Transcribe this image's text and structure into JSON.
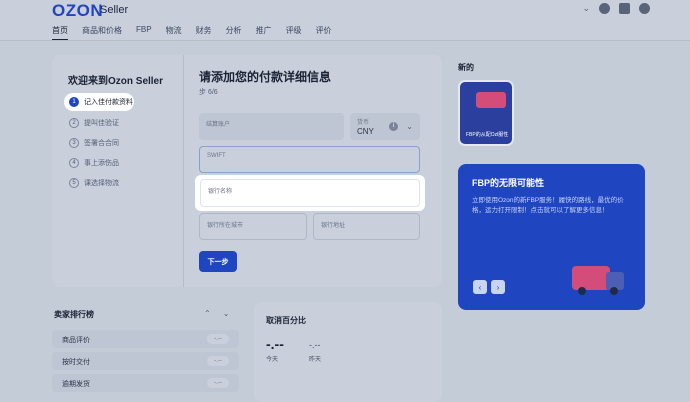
{
  "header": {
    "logo": "OZON",
    "logo_sub": "Seller",
    "nav": [
      "首页",
      "商品和价格",
      "FBP",
      "物流",
      "财务",
      "分析",
      "推广",
      "评级",
      "评价"
    ]
  },
  "onboarding": {
    "welcome": "欢迎来到Ozon Seller",
    "steps": [
      {
        "num": "1",
        "label": "记入佳付款资料"
      },
      {
        "num": "2",
        "label": "提叫佳验证"
      },
      {
        "num": "3",
        "label": "签署合合同"
      },
      {
        "num": "4",
        "label": "事上添伤品"
      },
      {
        "num": "5",
        "label": "课选择物流"
      }
    ],
    "form_title": "请添加您的付款详细信息",
    "form_step": "步 6/6",
    "account_label": "结算账户",
    "currency_label": "货币",
    "currency_value": "CNY",
    "swift_label": "SWIFT",
    "bank_name_label": "银行名称",
    "bank_city_label": "银行所在城市",
    "bank_address_label": "银行地址",
    "next_button": "下一步"
  },
  "new_section": {
    "title": "新的",
    "tile_text": "FBP的从配Ozl服性"
  },
  "promo": {
    "title": "FBP的无限可能性",
    "body": "立即使用Ozon的新FBP服务！履快的路线，最优的价格，运力打开限制！点击就可以了解更多信息！",
    "prev": "‹",
    "next": "›"
  },
  "rankings": {
    "title": "卖家排行榜",
    "rows": [
      {
        "label": "商品评价",
        "value": "-.--"
      },
      {
        "label": "按时交付",
        "value": "-.--"
      },
      {
        "label": "逾期发货",
        "value": "-.--"
      }
    ]
  },
  "cancel": {
    "title": "取消百分比",
    "today_value": "-.--",
    "yesterday_value": "-.--",
    "today_label": "今天",
    "yesterday_label": "昨天"
  }
}
